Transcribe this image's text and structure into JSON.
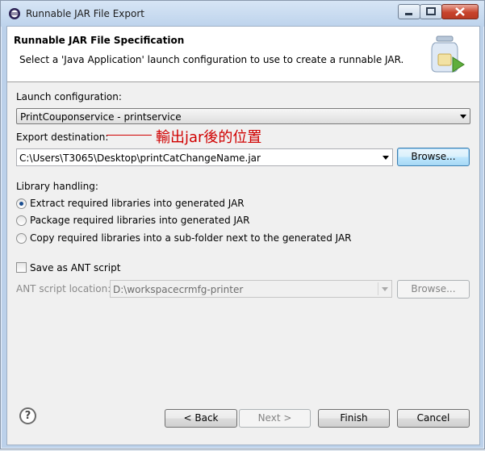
{
  "window": {
    "title": "Runnable JAR File Export"
  },
  "header": {
    "title": "Runnable JAR File Specification",
    "description": "Select a 'Java Application' launch configuration to use to create a runnable JAR."
  },
  "launch": {
    "label": "Launch configuration:",
    "selected": "PrintCouponservice - printservice"
  },
  "export": {
    "label": "Export destination:",
    "value": "C:\\Users\\T3065\\Desktop\\printCatChangeName.jar",
    "browse_label": "Browse..."
  },
  "annotation": {
    "text": "輸出jar後的位置",
    "color": "#d00000"
  },
  "library": {
    "label": "Library handling:",
    "options": [
      {
        "label": "Extract required libraries into generated JAR",
        "checked": true
      },
      {
        "label": "Package required libraries into generated JAR",
        "checked": false
      },
      {
        "label": "Copy required libraries into a sub-folder next to the generated JAR",
        "checked": false
      }
    ]
  },
  "ant": {
    "save_label": "Save as ANT script",
    "save_checked": false,
    "location_label": "ANT script location:",
    "location_value": "D:\\workspacecrmfg-printer",
    "browse_label": "Browse..."
  },
  "footer": {
    "help_symbol": "?",
    "back_label": "< Back",
    "next_label": "Next >",
    "finish_label": "Finish",
    "cancel_label": "Cancel"
  }
}
